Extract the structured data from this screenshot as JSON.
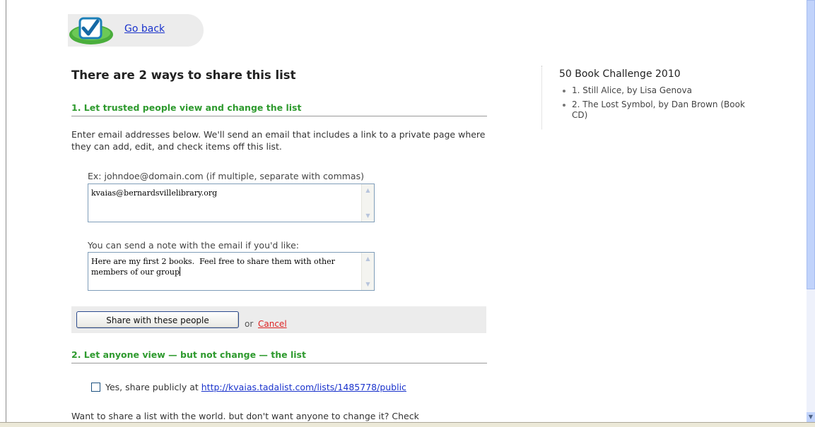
{
  "header": {
    "go_back_label": "Go back"
  },
  "main": {
    "title": "There are 2 ways to share this list",
    "section1_title": "1. Let trusted people view and change the list",
    "intro": "Enter email addresses below. We'll send an email that includes a link to a private page where they can add, edit, and check items off this list.",
    "email_hint": "Ex: johndoe@domain.com (if multiple, separate with commas)",
    "email_value": "kvaias@bernardsvillelibrary.org",
    "note_label": "You can send a note with the email if you'd like:",
    "note_value": "Here are my first 2 books.  Feel free to share them with other members of our group",
    "share_button_label": "Share with these people",
    "or_text": "or",
    "cancel_label": "Cancel",
    "section2_title": "2. Let anyone view — but not change — the list",
    "public_label": "Yes, share publicly at",
    "public_url": "http://kvaias.tadalist.com/lists/1485778/public",
    "cut_text": "Want to share a list with the world. but don't want anyone to change it? Check"
  },
  "sidebar": {
    "title": "50 Book Challenge 2010",
    "items": [
      "1. Still Alice, by Lisa Genova",
      "2. The Lost Symbol, by Dan Brown (Book CD)"
    ]
  },
  "icons": {
    "logo": "checkmark-logo-icon",
    "scroll_up": "scroll-up-icon",
    "scroll_down": "scroll-down-icon"
  },
  "colors": {
    "section_green": "#2e9a2e",
    "link_blue": "#1a33cc",
    "cancel_red": "#dd2222"
  }
}
